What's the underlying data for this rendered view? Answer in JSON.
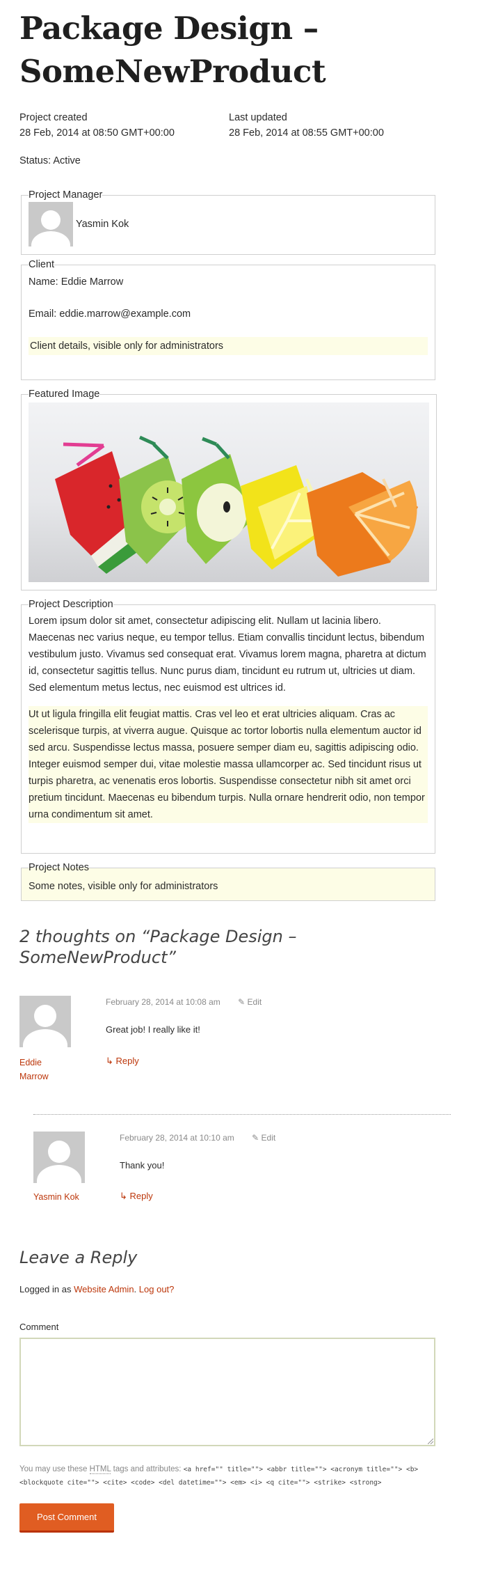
{
  "page": {
    "title": "Package Design – SomeNewProduct"
  },
  "meta": {
    "created_label": "Project created",
    "created_value": "28 Feb, 2014 at 08:50 GMT+00:00",
    "updated_label": "Last updated",
    "updated_value": "28 Feb, 2014 at 08:55 GMT+00:00",
    "status": "Status: Active"
  },
  "project_manager": {
    "legend": "Project Manager",
    "name": "Yasmin Kok"
  },
  "client": {
    "legend": "Client",
    "name": "Name: Eddie Marrow",
    "email": "Email: eddie.marrow@example.com",
    "admin_note": "Client details, visible only for administrators"
  },
  "featured_image": {
    "legend": "Featured Image"
  },
  "description": {
    "legend": "Project Description",
    "paragraph1": "Lorem ipsum dolor sit amet, consectetur adipiscing elit. Nullam ut lacinia libero. Maecenas nec varius neque, eu tempor tellus. Etiam convallis tincidunt lectus, bibendum vestibulum justo. Vivamus sed consequat erat. Vivamus lorem magna, pharetra at dictum id, consectetur sagittis tellus. Nunc purus diam, tincidunt eu rutrum ut, ultricies ut diam. Sed elementum metus lectus, nec euismod est ultrices id.",
    "paragraph2": "Ut ut ligula fringilla elit feugiat mattis. Cras vel leo et erat ultricies aliquam. Cras ac scelerisque turpis, at viverra augue. Quisque ac tortor lobortis nulla elementum auctor id sed arcu. Suspendisse lectus massa, posuere semper diam eu, sagittis adipiscing odio. Integer euismod semper dui, vitae molestie massa ullamcorper ac. Sed tincidunt risus ut turpis pharetra, ac venenatis eros lobortis. Suspendisse consectetur nibh sit amet orci pretium tincidunt. Maecenas eu bibendum turpis. Nulla ornare hendrerit odio, non tempor urna condimentum sit amet."
  },
  "notes": {
    "legend": "Project Notes",
    "text": "Some notes, visible only for administrators"
  },
  "comments": {
    "title": "2 thoughts on “Package Design – SomeNewProduct”",
    "items": [
      {
        "author": "Eddie Marrow",
        "date": "February 28, 2014 at 10:08 am",
        "edit": "Edit",
        "text": "Great job! I really like it!",
        "reply": "Reply"
      },
      {
        "author": "Yasmin Kok",
        "date": "February 28, 2014 at 10:10 am",
        "edit": "Edit",
        "text": "Thank you!",
        "reply": "Reply"
      }
    ]
  },
  "reply_form": {
    "title": "Leave a Reply",
    "logged_prefix": "Logged in as ",
    "logged_user": "Website Admin",
    "logout": "Log out?",
    "comment_label": "Comment",
    "allowed_prefix": "You may use these ",
    "allowed_abbr": "HTML",
    "allowed_middle": " tags and attributes: ",
    "allowed_tags": "<a href=\"\" title=\"\"> <abbr title=\"\"> <acronym title=\"\"> <b> <blockquote cite=\"\"> <cite> <code> <del datetime=\"\"> <em> <i> <q cite=\"\"> <strike> <strong>",
    "submit_label": "Post Comment"
  },
  "colors": {
    "link": "#bc360a",
    "button": "#e05d22",
    "highlight": "#fdfde6"
  }
}
